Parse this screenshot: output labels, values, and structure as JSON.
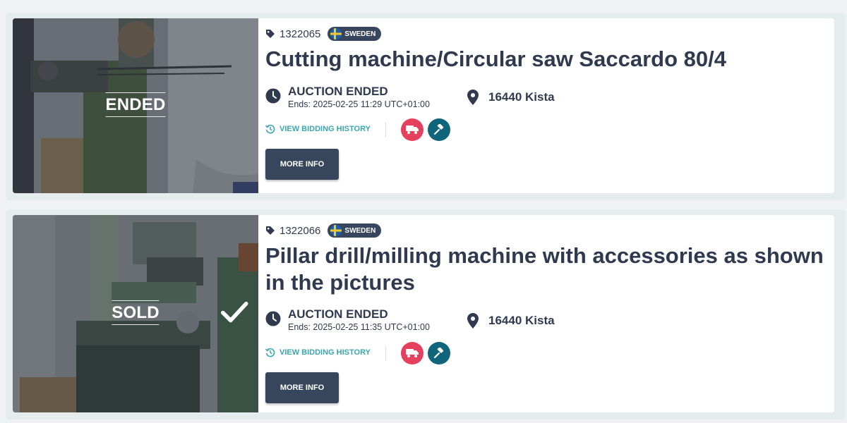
{
  "colors": {
    "page_bg": "#eef2f3",
    "text_primary": "#2f3a4f",
    "badge_bg": "#37465c",
    "link_teal": "#3aa6b0",
    "delivery_red": "#e5405e",
    "auction_teal": "#10657a",
    "button_bg": "#37465c"
  },
  "listings": [
    {
      "lot_number": "1322065",
      "country": "SWEDEN",
      "title": "Cutting machine/Circular saw Saccardo 80/4",
      "overlay_status": "ENDED",
      "status": "AUCTION ENDED",
      "ends": "Ends: 2025-02-25 11:29 UTC+01:00",
      "location": "16440 Kista",
      "bid_history_label": "VIEW BIDDING HISTORY",
      "more_info_label": "MORE INFO",
      "icons": [
        "tag-icon",
        "sweden-flag-icon",
        "clock-icon",
        "location-pin-icon",
        "history-icon",
        "delivery-truck-icon",
        "auction-gavel-icon"
      ]
    },
    {
      "lot_number": "1322066",
      "country": "SWEDEN",
      "title": "Pillar drill/milling machine with accessories as shown in the pictures",
      "overlay_status": "SOLD",
      "status": "AUCTION ENDED",
      "ends": "Ends: 2025-02-25 11:35 UTC+01:00",
      "location": "16440 Kista",
      "bid_history_label": "VIEW BIDDING HISTORY",
      "more_info_label": "MORE INFO",
      "icons": [
        "tag-icon",
        "sweden-flag-icon",
        "check-icon",
        "clock-icon",
        "location-pin-icon",
        "history-icon",
        "delivery-truck-icon",
        "auction-gavel-icon"
      ]
    }
  ]
}
